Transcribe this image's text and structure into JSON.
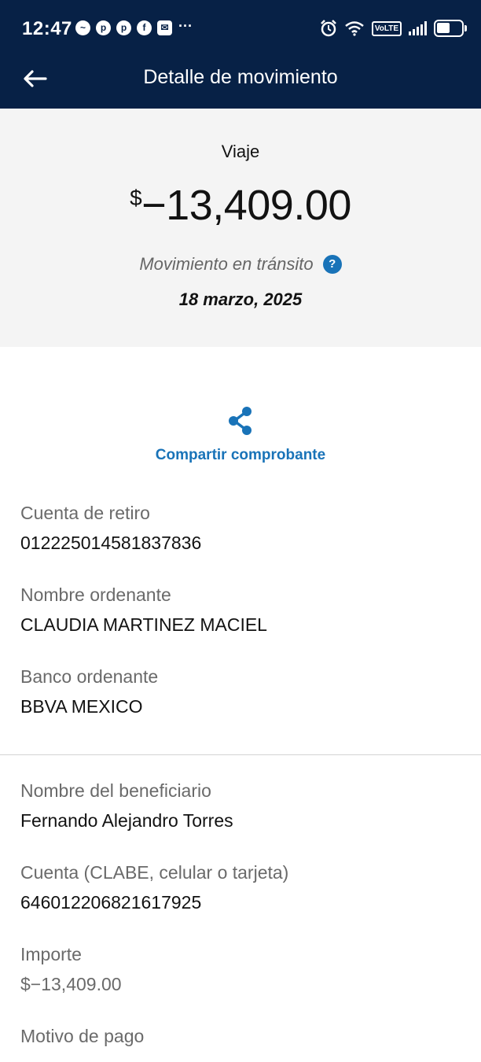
{
  "status_bar": {
    "time": "12:47",
    "volte": "VoLTE",
    "notification_icons": [
      "messenger-icon",
      "pinterest-icon",
      "pinterest-icon",
      "facebook-icon",
      "mail-icon",
      "more-icon"
    ]
  },
  "header": {
    "title": "Detalle de movimiento"
  },
  "summary": {
    "concept": "Viaje",
    "currency": "$",
    "amount": "−13,409.00",
    "status": "Movimiento en tránsito",
    "help": "?",
    "date": "18 marzo, 2025"
  },
  "share": {
    "label": "Compartir comprobante"
  },
  "details": {
    "origin": [
      {
        "label": "Cuenta de retiro",
        "value": "012225014581837836"
      },
      {
        "label": "Nombre ordenante",
        "value": "CLAUDIA MARTINEZ MACIEL"
      },
      {
        "label": "Banco ordenante",
        "value": "BBVA MEXICO"
      }
    ],
    "beneficiary": [
      {
        "label": "Nombre del beneficiario",
        "value": "Fernando Alejandro Torres"
      },
      {
        "label": "Cuenta (CLABE, celular o tarjeta)",
        "value": "646012206821617925"
      },
      {
        "label": "Importe",
        "value": "$−13,409.00"
      },
      {
        "label": "Motivo de pago",
        "value": ""
      }
    ]
  },
  "colors": {
    "header_bg": "#072146",
    "accent_blue": "#1973b8",
    "summary_bg": "#f4f4f4"
  }
}
